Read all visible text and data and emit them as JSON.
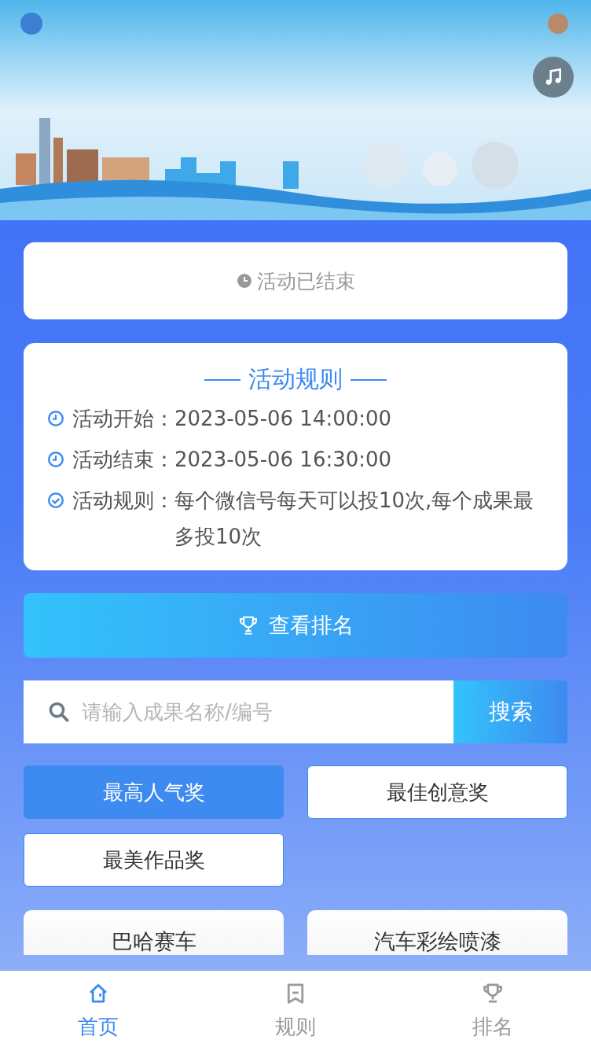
{
  "status": {
    "text": "活动已结束"
  },
  "rules": {
    "title": "活动规则",
    "items": [
      {
        "kind": "time",
        "label": "活动开始：",
        "value": "2023-05-06 14:00:00"
      },
      {
        "kind": "time",
        "label": "活动结束：",
        "value": "2023-05-06 16:30:00"
      },
      {
        "kind": "check",
        "label": "活动规则：",
        "value": "每个微信号每天可以投10次,每个成果最多投10次"
      }
    ]
  },
  "ranking_button": {
    "label": "查看排名"
  },
  "search": {
    "placeholder": "请输入成果名称/编号",
    "button": "搜索"
  },
  "awards": [
    {
      "label": "最高人气奖",
      "selected": true
    },
    {
      "label": "最佳创意奖",
      "selected": false
    },
    {
      "label": "最美作品奖",
      "selected": false
    }
  ],
  "entries": [
    {
      "title": "巴哈赛车"
    },
    {
      "title": "汽车彩绘喷漆"
    }
  ],
  "bottom_nav": [
    {
      "kind": "home",
      "label": "首页",
      "selected": true
    },
    {
      "kind": "rules",
      "label": "规则",
      "selected": false
    },
    {
      "kind": "trophy",
      "label": "排名",
      "selected": false
    }
  ]
}
